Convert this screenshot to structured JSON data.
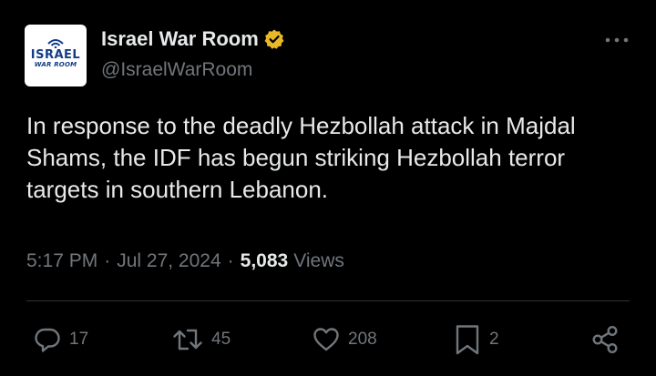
{
  "author": {
    "display_name": "Israel War Room",
    "handle": "@IsraelWarRoom",
    "verified_color": "#e8b829",
    "avatar": {
      "logo_line1": "ISRAEL",
      "logo_line2": "WAR ROOM"
    }
  },
  "tweet": {
    "text": "In response to the deadly Hezbollah attack in Majdal Shams, the IDF has begun striking Hezbollah terror targets in southern Lebanon.",
    "time": "5:17 PM",
    "date": "Jul 27, 2024",
    "views_count": "5,083",
    "views_label": "Views",
    "separator": "·"
  },
  "actions": {
    "reply": {
      "icon": "reply-icon",
      "count": "17"
    },
    "retweet": {
      "icon": "retweet-icon",
      "count": "45"
    },
    "like": {
      "icon": "heart-icon",
      "count": "208"
    },
    "bookmark": {
      "icon": "bookmark-icon",
      "count": "2"
    },
    "share": {
      "icon": "share-icon"
    }
  },
  "colors": {
    "background": "#000000",
    "primary_text": "#e7e9ea",
    "secondary_text": "#71767b",
    "divider": "#2f3336",
    "logo_blue": "#143c86"
  }
}
